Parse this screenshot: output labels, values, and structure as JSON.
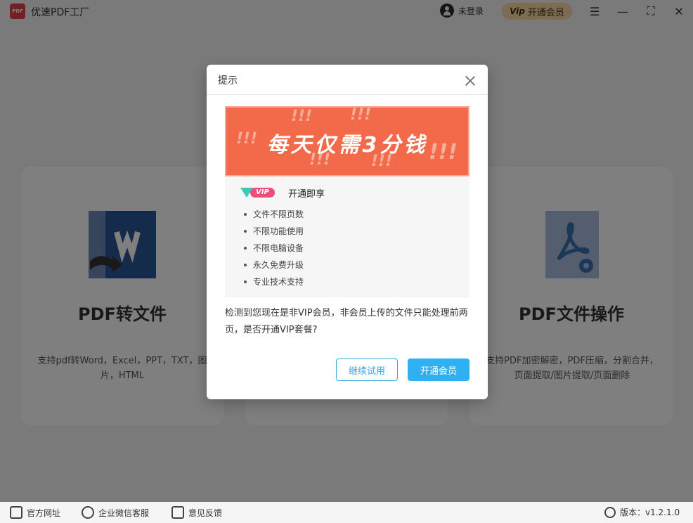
{
  "app": {
    "title": "优速PDF工厂",
    "logo_text": "PDF",
    "login_label": "未登录",
    "vip_mark": "Vip",
    "vip_button": "开通会员",
    "menu_icon": "☰",
    "minimize_icon": "—",
    "maximize_icon": "⛶",
    "close_icon": "✕"
  },
  "cards": [
    {
      "title": "PDF转文件",
      "desc": "支持pdf转Word，Excel，PPT，TXT，图片，HTML"
    },
    {
      "title": "PDF文件操作",
      "desc": "支持PDF加密解密，PDF压缩，分割合并，页面提取/图片提取/页面删除"
    }
  ],
  "footer": {
    "website": "官方网址",
    "wechat": "企业微信客服",
    "feedback": "意见反馈",
    "version": "版本：v1.2.1.0"
  },
  "dialog": {
    "title": "提示",
    "promo": "每天仅需3分钱",
    "vip_badge": "VIP",
    "benefits_heading": "开通即享",
    "benefits": [
      "文件不限页数",
      "不限功能使用",
      "不限电脑设备",
      "永久免费升级",
      "专业技术支持"
    ],
    "notice": "检测到您现在是非VIP会员，非会员上传的文件只能处理前两页，是否开通VIP套餐?",
    "trial_button": "继续试用",
    "open_button": "开通会员"
  },
  "colors": {
    "promo_bg": "#f36a4a",
    "primary_button": "#2fb0f0",
    "vip_gold": "#f6d9a6",
    "word_blue": "#2b5797",
    "pdf_blue": "#3a6fb0"
  }
}
